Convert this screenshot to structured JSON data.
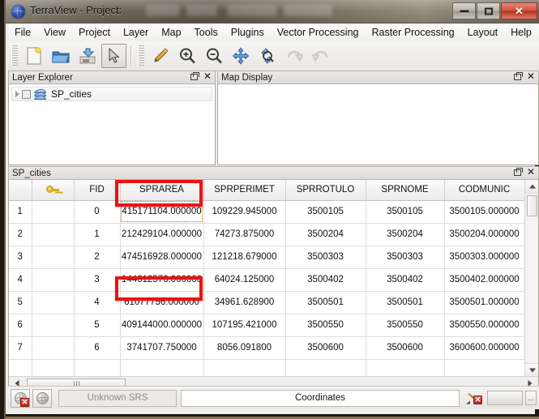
{
  "window": {
    "title": "TerraView - Project:",
    "app_icon": "globe-icon",
    "controls": {
      "minimize": "minimize-icon",
      "maximize": "maximize-icon",
      "close": "close-icon"
    }
  },
  "menubar": {
    "items": [
      {
        "label": "File"
      },
      {
        "label": "View"
      },
      {
        "label": "Project"
      },
      {
        "label": "Layer"
      },
      {
        "label": "Map"
      },
      {
        "label": "Tools"
      },
      {
        "label": "Plugins"
      },
      {
        "label": "Vector Processing"
      },
      {
        "label": "Raster Processing"
      },
      {
        "label": "Layout"
      },
      {
        "label": "Help"
      }
    ]
  },
  "toolbar": {
    "groups": [
      {
        "buttons": [
          {
            "icon": "new-document-icon",
            "active": false
          },
          {
            "icon": "open-folder-icon",
            "active": false
          },
          {
            "icon": "save-icon",
            "active": false
          },
          {
            "icon": "pointer-arrow-icon",
            "active": true
          }
        ]
      },
      {
        "buttons": [
          {
            "icon": "pen-draw-icon",
            "active": false
          },
          {
            "icon": "zoom-in-icon",
            "active": false
          },
          {
            "icon": "zoom-out-icon",
            "active": false
          },
          {
            "icon": "pan-move-icon",
            "active": false
          },
          {
            "icon": "zoom-extent-icon",
            "active": false
          },
          {
            "icon": "undo-icon",
            "active": false,
            "disabled": true
          },
          {
            "icon": "redo-icon",
            "active": false,
            "disabled": true
          }
        ]
      }
    ]
  },
  "layer_explorer": {
    "title": "Layer Explorer",
    "float_icon": "float-icon",
    "close_icon": "close-icon",
    "tree": [
      {
        "label": "SP_cities",
        "checked": false,
        "expandable": true,
        "icon": "layers-icon"
      }
    ]
  },
  "map_display": {
    "title": "Map Display",
    "float_icon": "float-icon",
    "close_icon": "close-icon"
  },
  "attribute_table": {
    "title": "SP_cities",
    "float_icon": "float-icon",
    "close_icon": "close-icon",
    "columns": [
      {
        "label": "",
        "kind": "rownum"
      },
      {
        "label": "",
        "kind": "keyicon"
      },
      {
        "label": "FID"
      },
      {
        "label": "SPRAREA",
        "selected": true
      },
      {
        "label": "SPRPERIMET"
      },
      {
        "label": "SPRROTULO"
      },
      {
        "label": "SPRNOME"
      },
      {
        "label": "CODMUNIC"
      }
    ],
    "rows": [
      {
        "num": "1",
        "key": "",
        "fid": "0",
        "sprarea": "415171104.000000",
        "sprperimet": "109229.945000",
        "sprrotulo": "3500105",
        "sprnome": "3500105",
        "codmunic": "3500105.000000"
      },
      {
        "num": "2",
        "key": "",
        "fid": "1",
        "sprarea": "212429104.000000",
        "sprperimet": "74273.875000",
        "sprrotulo": "3500204",
        "sprnome": "3500204",
        "codmunic": "3500204.000000"
      },
      {
        "num": "3",
        "key": "",
        "fid": "2",
        "sprarea": "474516928.000000",
        "sprperimet": "121218.679000",
        "sprrotulo": "3500303",
        "sprnome": "3500303",
        "codmunic": "3500303.000000"
      },
      {
        "num": "4",
        "key": "",
        "fid": "3",
        "sprarea": "144612576.000000",
        "sprperimet": "64024.125000",
        "sprrotulo": "3500402",
        "sprnome": "3500402",
        "codmunic": "3500402.000000"
      },
      {
        "num": "5",
        "key": "",
        "fid": "4",
        "sprarea": "61077756.000000",
        "sprperimet": "34961.628900",
        "sprrotulo": "3500501",
        "sprnome": "3500501",
        "codmunic": "3500501.000000"
      },
      {
        "num": "6",
        "key": "",
        "fid": "5",
        "sprarea": "409144000.000000",
        "sprperimet": "107195.421000",
        "sprrotulo": "3500550",
        "sprnome": "3500550",
        "codmunic": "3500550.000000"
      },
      {
        "num": "7",
        "key": "",
        "fid": "6",
        "sprarea": "3741707.750000",
        "sprperimet": "8056.091800",
        "sprrotulo": "3500600",
        "sprnome": "3500600",
        "codmunic": "3600600.000000"
      }
    ],
    "highlight_color": "#3d9ff0",
    "header_highlight_color": "#49b6e8",
    "annotation_color": "#ee1111"
  },
  "statusbar": {
    "srs_label": "Unknown SRS",
    "coordinates_label": "Coordinates",
    "buttons": [
      {
        "icon": "globe-error-icon"
      },
      {
        "icon": "globe-icon"
      },
      {
        "icon": "pen-error-icon"
      }
    ],
    "overflow_label": "..."
  }
}
